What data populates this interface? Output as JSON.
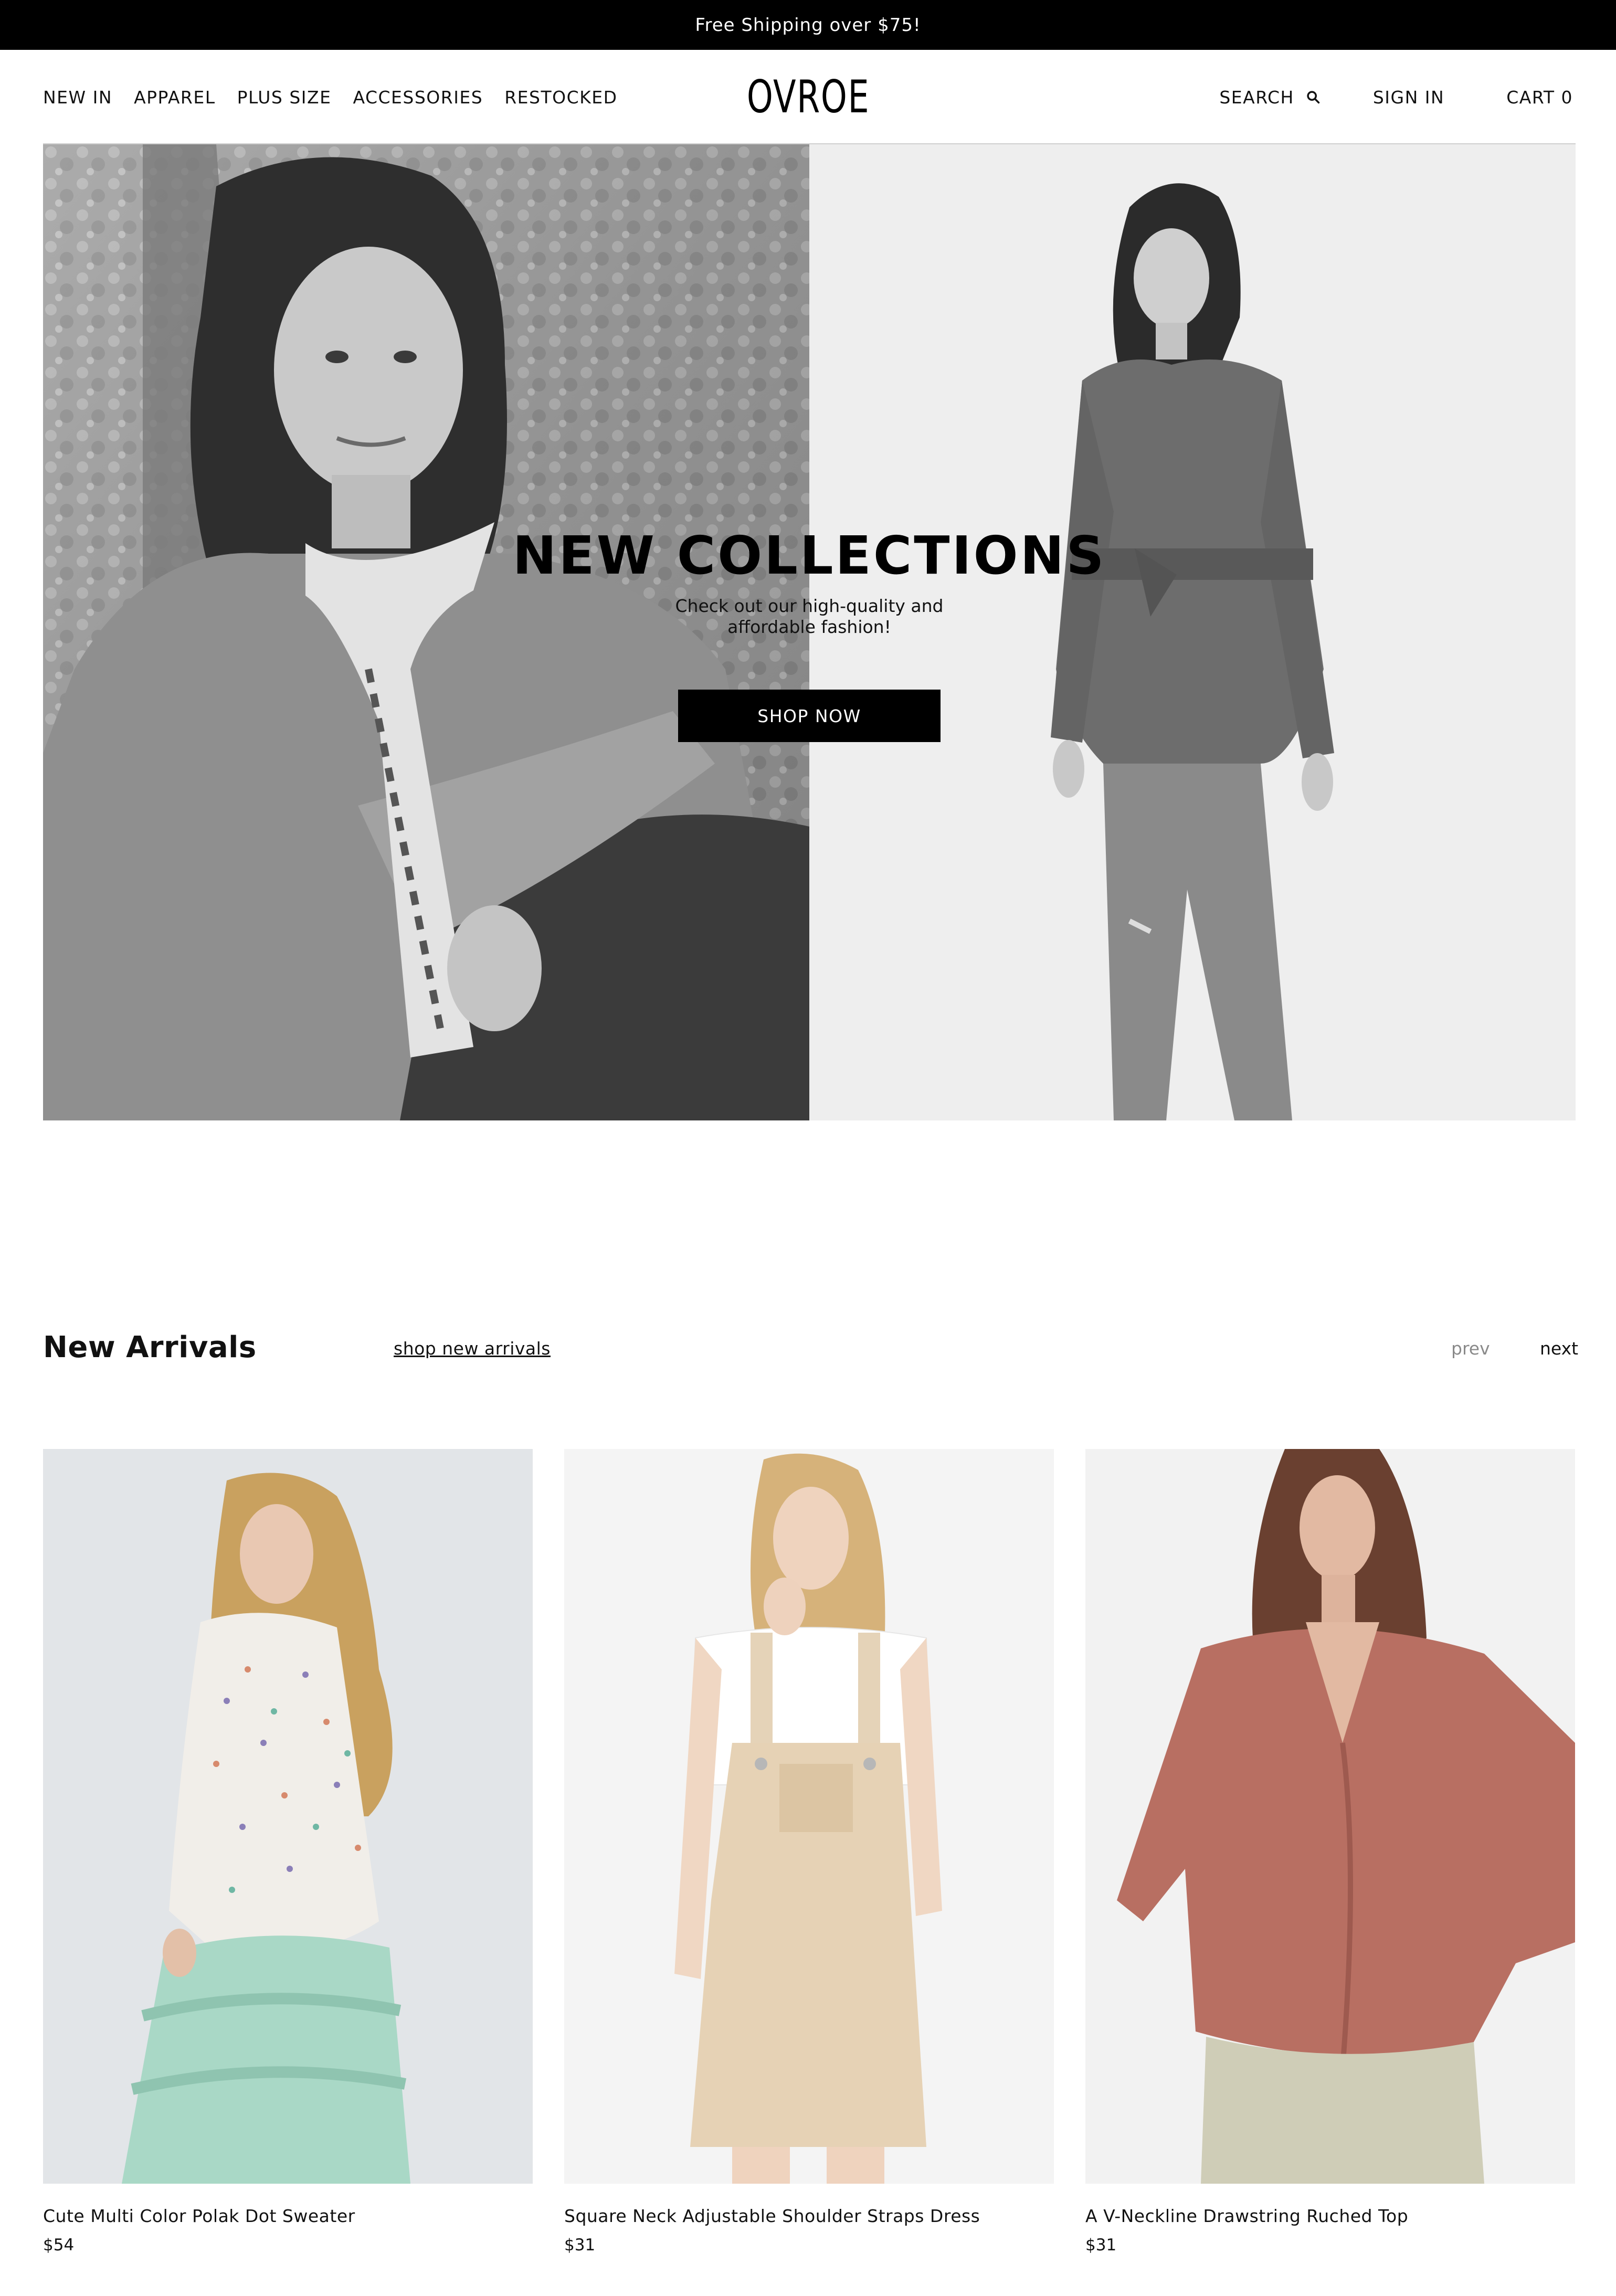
{
  "announcement": {
    "text": "Free Shipping over $75!"
  },
  "header": {
    "nav_left": [
      "NEW IN",
      "APPAREL",
      "PLUS SIZE",
      "ACCESSORIES",
      "RESTOCKED"
    ],
    "logo": "OVROE",
    "search_label": "SEARCH",
    "signin_label": "SIGN IN",
    "cart_label": "CART 0"
  },
  "hero": {
    "title": "NEW COLLECTIONS",
    "subtitle": "Check out our high-quality and affordable fashion!",
    "cta_label": "SHOP NOW"
  },
  "arrivals": {
    "title": "New Arrivals",
    "link_label": "shop new arrivals",
    "prev_label": "prev",
    "next_label": "next",
    "products": [
      {
        "name": "Cute Multi Color Polak Dot Sweater",
        "price": "$54"
      },
      {
        "name": "Square Neck Adjustable Shoulder Straps Dress",
        "price": "$31"
      },
      {
        "name": "A V-Neckline Drawstring Ruched Top",
        "price": "$31"
      }
    ]
  },
  "colors": {
    "announcement_bg": "#000000",
    "button_bg": "#000000",
    "muted_link": "#8a8a8a"
  },
  "icons": {
    "search": "search-icon"
  }
}
